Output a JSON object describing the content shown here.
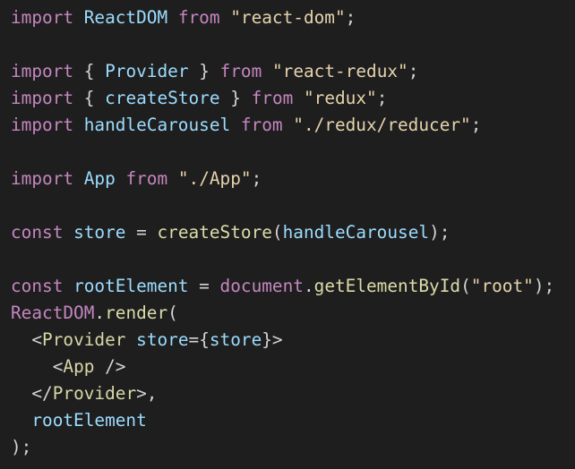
{
  "colors": {
    "background": "#1e1e1e",
    "keyword": "#c586c0",
    "identifier": "#9cdcfe",
    "string": "#e6d3ad",
    "punctuation": "#d4d4d4",
    "function": "#dcdcaa",
    "tag": "#d7d7a8"
  },
  "code": {
    "lines": [
      [
        [
          "keyword",
          "import"
        ],
        [
          "plain",
          " "
        ],
        [
          "ident",
          "ReactDOM"
        ],
        [
          "plain",
          " "
        ],
        [
          "keyword",
          "from"
        ],
        [
          "plain",
          " "
        ],
        [
          "string",
          "\"react-dom\""
        ],
        [
          "punct",
          ";"
        ]
      ],
      [],
      [
        [
          "keyword",
          "import"
        ],
        [
          "plain",
          " "
        ],
        [
          "punct",
          "{"
        ],
        [
          "plain",
          " "
        ],
        [
          "ident",
          "Provider"
        ],
        [
          "plain",
          " "
        ],
        [
          "punct",
          "}"
        ],
        [
          "plain",
          " "
        ],
        [
          "keyword",
          "from"
        ],
        [
          "plain",
          " "
        ],
        [
          "string",
          "\"react-redux\""
        ],
        [
          "punct",
          ";"
        ]
      ],
      [
        [
          "keyword",
          "import"
        ],
        [
          "plain",
          " "
        ],
        [
          "punct",
          "{"
        ],
        [
          "plain",
          " "
        ],
        [
          "ident",
          "createStore"
        ],
        [
          "plain",
          " "
        ],
        [
          "punct",
          "}"
        ],
        [
          "plain",
          " "
        ],
        [
          "keyword",
          "from"
        ],
        [
          "plain",
          " "
        ],
        [
          "string",
          "\"redux\""
        ],
        [
          "punct",
          ";"
        ]
      ],
      [
        [
          "keyword",
          "import"
        ],
        [
          "plain",
          " "
        ],
        [
          "ident",
          "handleCarousel"
        ],
        [
          "plain",
          " "
        ],
        [
          "keyword",
          "from"
        ],
        [
          "plain",
          " "
        ],
        [
          "string",
          "\"./redux/reducer\""
        ],
        [
          "punct",
          ";"
        ]
      ],
      [],
      [
        [
          "keyword",
          "import"
        ],
        [
          "plain",
          " "
        ],
        [
          "ident",
          "App"
        ],
        [
          "plain",
          " "
        ],
        [
          "keyword",
          "from"
        ],
        [
          "plain",
          " "
        ],
        [
          "string",
          "\"./App\""
        ],
        [
          "punct",
          ";"
        ]
      ],
      [],
      [
        [
          "keyword",
          "const"
        ],
        [
          "plain",
          " "
        ],
        [
          "ident",
          "store"
        ],
        [
          "plain",
          " "
        ],
        [
          "punct",
          "="
        ],
        [
          "plain",
          " "
        ],
        [
          "func",
          "createStore"
        ],
        [
          "punct",
          "("
        ],
        [
          "ident",
          "handleCarousel"
        ],
        [
          "punct",
          ");"
        ]
      ],
      [],
      [
        [
          "keyword",
          "const"
        ],
        [
          "plain",
          " "
        ],
        [
          "ident",
          "rootElement"
        ],
        [
          "plain",
          " "
        ],
        [
          "punct",
          "="
        ],
        [
          "plain",
          " "
        ],
        [
          "builtin",
          "document"
        ],
        [
          "punct",
          "."
        ],
        [
          "func",
          "getElementById"
        ],
        [
          "punct",
          "("
        ],
        [
          "string",
          "\"root\""
        ],
        [
          "punct",
          ");"
        ]
      ],
      [
        [
          "builtin",
          "ReactDOM"
        ],
        [
          "punct",
          "."
        ],
        [
          "func",
          "render"
        ],
        [
          "punct",
          "("
        ]
      ],
      [
        [
          "indent",
          "  "
        ],
        [
          "punct",
          "<"
        ],
        [
          "tag",
          "Provider"
        ],
        [
          "plain",
          " "
        ],
        [
          "attr",
          "store"
        ],
        [
          "punct",
          "={"
        ],
        [
          "ident",
          "store"
        ],
        [
          "punct",
          "}>"
        ]
      ],
      [
        [
          "indent",
          "    "
        ],
        [
          "punct",
          "<"
        ],
        [
          "tag",
          "App"
        ],
        [
          "plain",
          " "
        ],
        [
          "punct",
          "/>"
        ]
      ],
      [
        [
          "indent",
          "  "
        ],
        [
          "punct",
          "</"
        ],
        [
          "tag",
          "Provider"
        ],
        [
          "punct",
          ">,"
        ]
      ],
      [
        [
          "indent",
          "  "
        ],
        [
          "ident",
          "rootElement"
        ]
      ],
      [
        [
          "punct",
          ");"
        ]
      ]
    ]
  }
}
